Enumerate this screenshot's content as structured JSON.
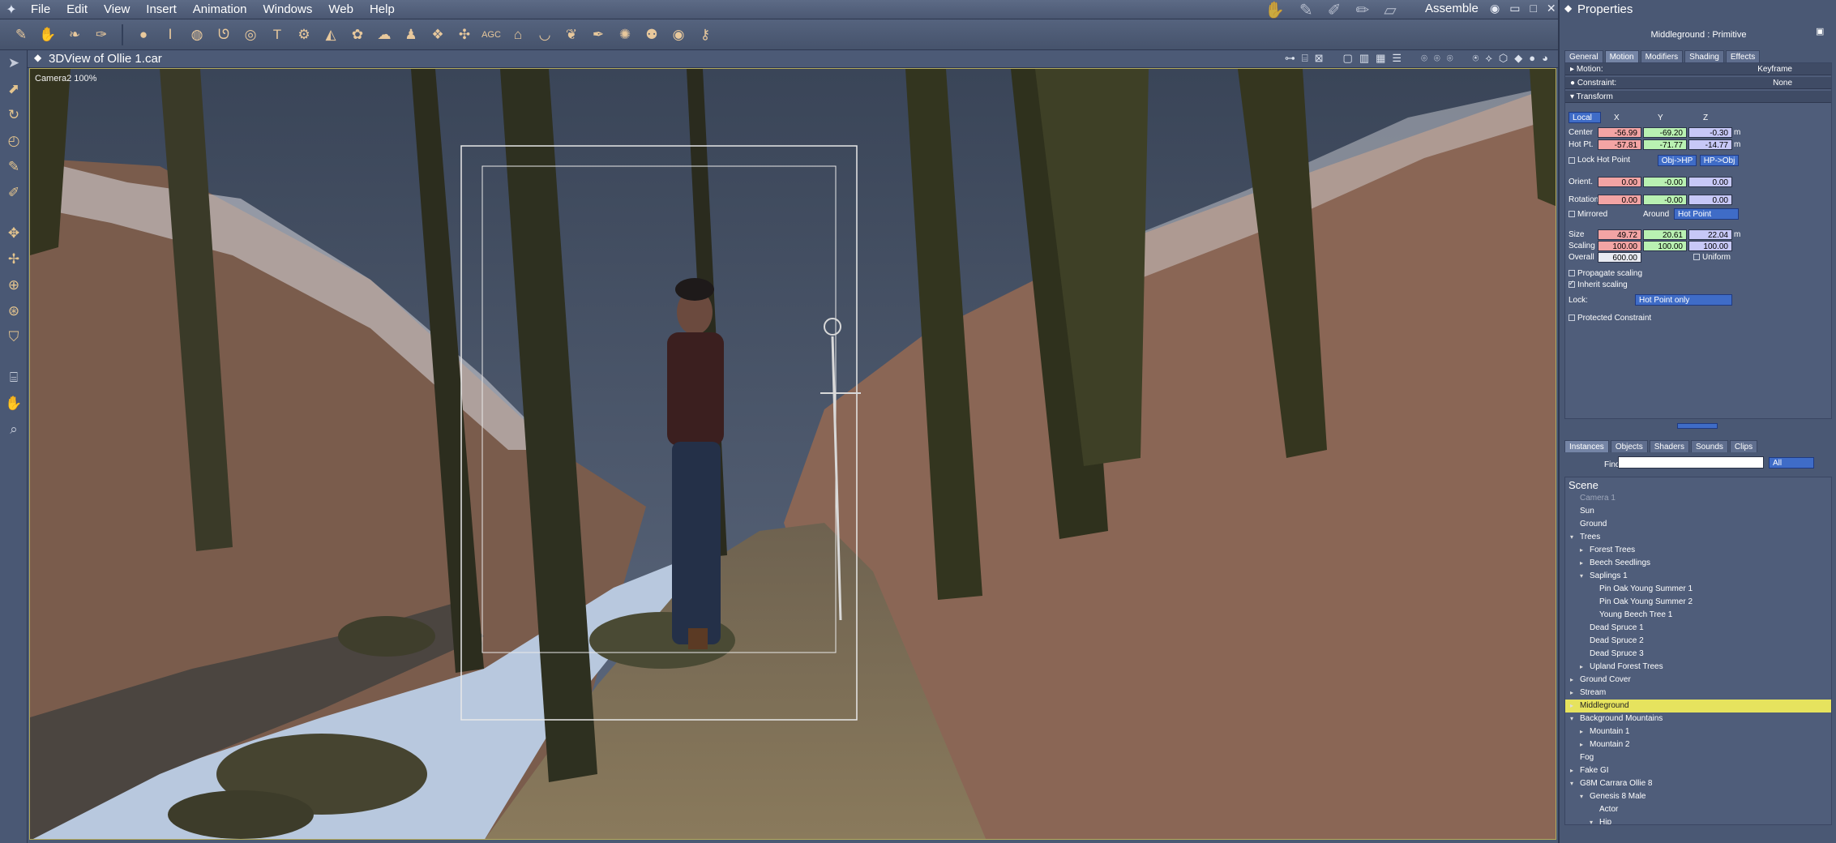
{
  "menubar": {
    "items": [
      "File",
      "Edit",
      "View",
      "Insert",
      "Animation",
      "Windows",
      "Web",
      "Help"
    ],
    "room": "Assemble"
  },
  "viewport": {
    "title": "3DView of Ollie 1.car",
    "camera_label": "Camera2 100%"
  },
  "properties": {
    "title": "Properties",
    "object": "Middleground : Primitive",
    "tabs": [
      "General",
      "Motion",
      "Modifiers",
      "Shading",
      "Effects"
    ],
    "active_tab": "Motion",
    "motion": {
      "label": "Motion:",
      "value": "Keyframe"
    },
    "constraint": {
      "label": "Constraint:",
      "value": "None"
    },
    "transform": {
      "label": "Transform",
      "space": "Local",
      "axes": [
        "X",
        "Y",
        "Z"
      ],
      "center": {
        "label": "Center",
        "x": "-56.99",
        "y": "-69.20",
        "z": "-0.30",
        "unit": "m"
      },
      "hotpt": {
        "label": "Hot Pt.",
        "x": "-57.81",
        "y": "-71.77",
        "z": "-14.77",
        "unit": "m"
      },
      "lock_hot_point": "Lock Hot Point",
      "obj_hp": "Obj->HP",
      "hp_obj": "HP->Obj",
      "orient": {
        "label": "Orient.",
        "x": "0.00",
        "y": "-0.00",
        "z": "0.00"
      },
      "rotation": {
        "label": "Rotation",
        "x": "0.00",
        "y": "-0.00",
        "z": "0.00"
      },
      "mirrored": "Mirrored",
      "around_label": "Around",
      "around_value": "Hot Point",
      "size": {
        "label": "Size",
        "x": "49.72",
        "y": "20.61",
        "z": "22.04",
        "unit": "m"
      },
      "scaling": {
        "label": "Scaling",
        "x": "100.00",
        "y": "100.00",
        "z": "100.00"
      },
      "overall": {
        "label": "Overall",
        "value": "600.00"
      },
      "uniform": "Uniform",
      "propagate_scaling": "Propagate scaling",
      "inherit_scaling": "Inherit scaling",
      "lock_label": "Lock:",
      "lock_value": "Hot Point only",
      "protected_constraint": "Protected Constraint"
    }
  },
  "instances": {
    "tabs": [
      "Instances",
      "Objects",
      "Shaders",
      "Sounds",
      "Clips"
    ],
    "find_label": "Find:",
    "find_value": "",
    "filter": "All",
    "tree": [
      {
        "label": "Scene",
        "level": 0,
        "arrow": "",
        "header": true
      },
      {
        "label": "Camera 1",
        "level": 1,
        "arrow": "",
        "dim": true
      },
      {
        "label": "Sun",
        "level": 1,
        "arrow": ""
      },
      {
        "label": "Ground",
        "level": 1,
        "arrow": ""
      },
      {
        "label": "Trees",
        "level": 1,
        "arrow": "open"
      },
      {
        "label": "Forest Trees",
        "level": 2,
        "arrow": "closed"
      },
      {
        "label": "Beech Seedlings",
        "level": 2,
        "arrow": "closed"
      },
      {
        "label": "Saplings 1",
        "level": 2,
        "arrow": "open"
      },
      {
        "label": "Pin Oak Young Summer 1",
        "level": 3,
        "arrow": ""
      },
      {
        "label": "Pin Oak Young Summer 2",
        "level": 3,
        "arrow": ""
      },
      {
        "label": "Young Beech Tree 1",
        "level": 3,
        "arrow": ""
      },
      {
        "label": "Dead Spruce 1",
        "level": 2,
        "arrow": ""
      },
      {
        "label": "Dead Spruce 2",
        "level": 2,
        "arrow": ""
      },
      {
        "label": "Dead Spruce 3",
        "level": 2,
        "arrow": ""
      },
      {
        "label": "Upland Forest Trees",
        "level": 2,
        "arrow": "closed"
      },
      {
        "label": "Ground Cover",
        "level": 1,
        "arrow": "closed"
      },
      {
        "label": "Stream",
        "level": 1,
        "arrow": "closed"
      },
      {
        "label": "Middleground",
        "level": 1,
        "arrow": "closed",
        "selected": true
      },
      {
        "label": "Background Mountains",
        "level": 1,
        "arrow": "open"
      },
      {
        "label": "Mountain 1",
        "level": 2,
        "arrow": "closed"
      },
      {
        "label": "Mountain 2",
        "level": 2,
        "arrow": "closed"
      },
      {
        "label": "Fog",
        "level": 1,
        "arrow": ""
      },
      {
        "label": "Fake GI",
        "level": 1,
        "arrow": "closed"
      },
      {
        "label": "G8M Carrara Ollie 8",
        "level": 1,
        "arrow": "open"
      },
      {
        "label": "Genesis 8 Male",
        "level": 2,
        "arrow": "open"
      },
      {
        "label": "Actor",
        "level": 3,
        "arrow": ""
      },
      {
        "label": "Hip",
        "level": 3,
        "arrow": "open"
      }
    ]
  },
  "colors": {
    "chrome": "#4a5874",
    "selection": "#e6e35e",
    "field_x": "#f3a4a4",
    "field_y": "#b9f1b2",
    "field_z": "#c7c8f7",
    "dropdown": "#3f6cc7"
  }
}
